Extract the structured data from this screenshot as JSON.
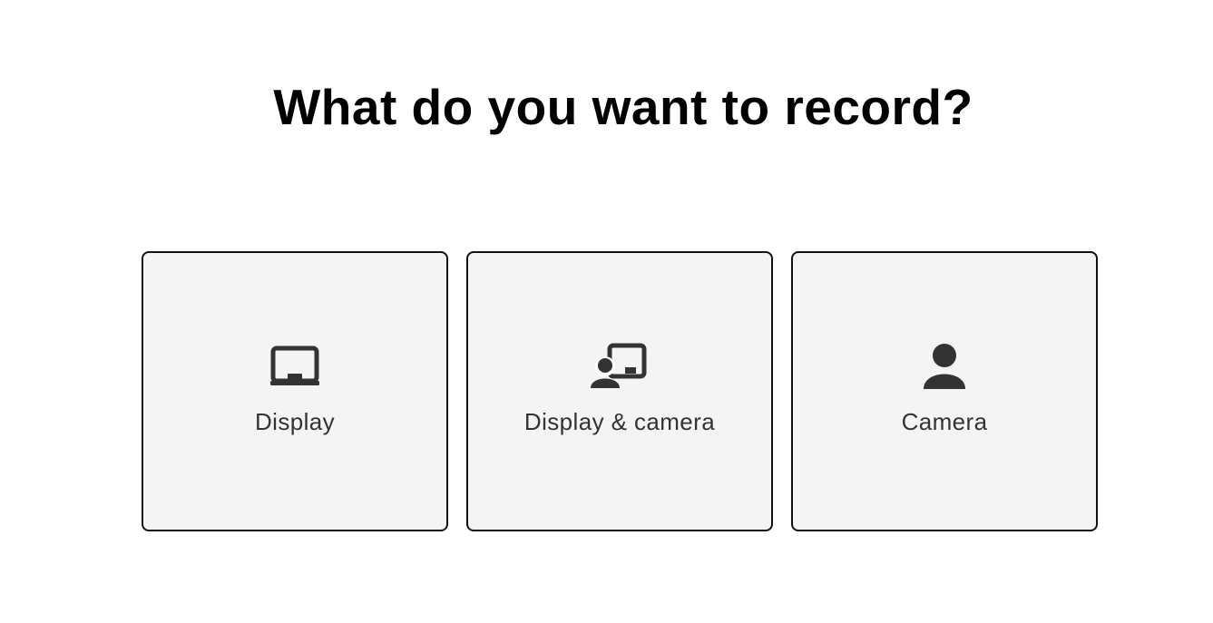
{
  "page": {
    "title": "What do you want to record?"
  },
  "options": [
    {
      "label": "Display",
      "icon": "display-icon"
    },
    {
      "label": "Display & camera",
      "icon": "display-camera-icon"
    },
    {
      "label": "Camera",
      "icon": "camera-person-icon"
    }
  ],
  "colors": {
    "card_background": "#f4f4f4",
    "card_border": "#111111",
    "icon": "#333333",
    "label": "#333333"
  }
}
